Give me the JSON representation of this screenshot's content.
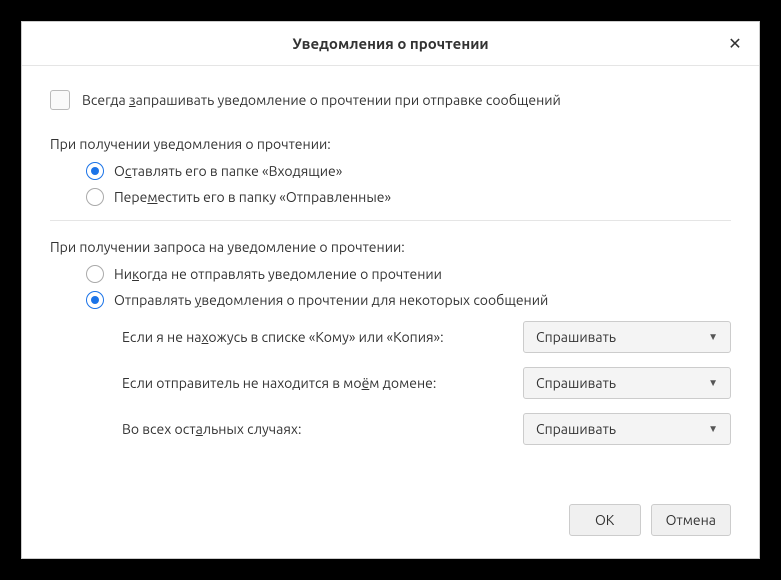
{
  "title": "Уведомления о прочтении",
  "always_request": {
    "pre": "Всегда ",
    "u": "з",
    "post": "апрашивать уведомление о прочтении при отправке сообщений"
  },
  "section1": {
    "label": "При получении уведомления о прочтении:",
    "opt1": {
      "pre": "О",
      "u": "с",
      "post": "тавлять его в папке «Входящие»"
    },
    "opt2": {
      "pre": "Пере",
      "u": "м",
      "post": "естить его в папку «Отправленные»"
    }
  },
  "section2": {
    "label": "При получении запроса на уведомление о прочтении:",
    "opt1": {
      "pre": "Ни",
      "u": "к",
      "post": "огда не отправлять уведомление о прочтении"
    },
    "opt2": {
      "pre": "Отправлять ",
      "u": "у",
      "post": "ведомления о прочтении для некоторых сообщений"
    }
  },
  "subs": {
    "r1": {
      "pre": "Если я не на",
      "u": "х",
      "post": "ожусь в списке «Кому» или «Копия»:"
    },
    "r2": {
      "pre": "Если отправитель не находится в мо",
      "u": "ё",
      "post": "м домене:"
    },
    "r3": {
      "pre": "Во всех ост",
      "u": "а",
      "post": "льных случаях:"
    }
  },
  "dropdown_value": "Спрашивать",
  "buttons": {
    "ok": "OK",
    "cancel": "Отмена"
  }
}
